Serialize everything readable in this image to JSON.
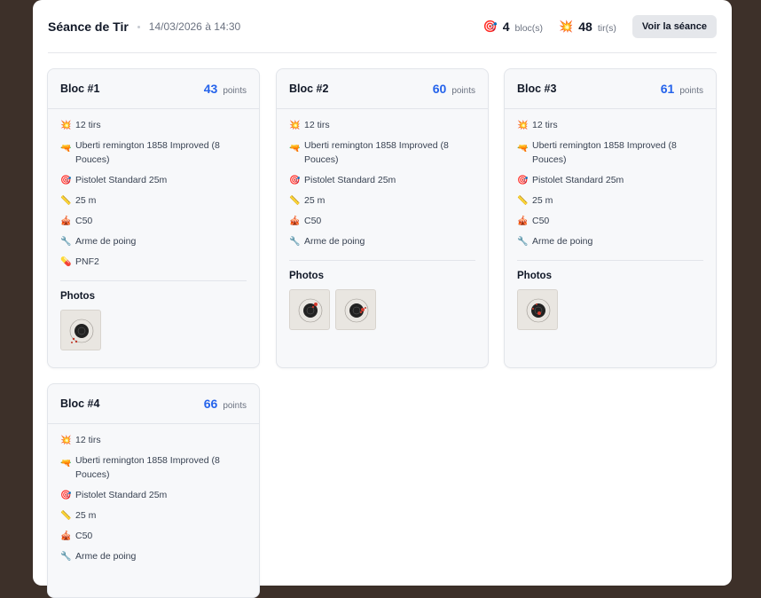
{
  "session": {
    "title": "Séance de Tir",
    "date": "14/03/2026 à 14:30",
    "blocks_count": "4",
    "blocks_label": "bloc(s)",
    "shots_count": "48",
    "shots_label": "tir(s)",
    "view_button": "Voir la séance"
  },
  "icons": {
    "target": "🎯",
    "shot": "💥",
    "gun": "🔫",
    "ruler": "📏",
    "circus": "🎪",
    "wrench": "🔧",
    "pill": "💊"
  },
  "blocks": [
    {
      "title": "Bloc #1",
      "points": "43",
      "points_label": "points",
      "shots": "12 tirs",
      "weapon": "Uberti remington 1858 Improved (8 Pouces)",
      "target": "Pistolet Standard 25m",
      "distance": "25 m",
      "caliber": "C50",
      "category": "Arme de poing",
      "ammo": "PNF2",
      "photos_label": "Photos"
    },
    {
      "title": "Bloc #2",
      "points": "60",
      "points_label": "points",
      "shots": "12 tirs",
      "weapon": "Uberti remington 1858 Improved (8 Pouces)",
      "target": "Pistolet Standard 25m",
      "distance": "25 m",
      "caliber": "C50",
      "category": "Arme de poing",
      "photos_label": "Photos"
    },
    {
      "title": "Bloc #3",
      "points": "61",
      "points_label": "points",
      "shots": "12 tirs",
      "weapon": "Uberti remington 1858 Improved (8 Pouces)",
      "target": "Pistolet Standard 25m",
      "distance": "25 m",
      "caliber": "C50",
      "category": "Arme de poing",
      "photos_label": "Photos"
    },
    {
      "title": "Bloc #4",
      "points": "66",
      "points_label": "points",
      "shots": "12 tirs",
      "weapon": "Uberti remington 1858 Improved (8 Pouces)",
      "target": "Pistolet Standard 25m",
      "distance": "25 m",
      "caliber": "C50",
      "category": "Arme de poing"
    }
  ]
}
